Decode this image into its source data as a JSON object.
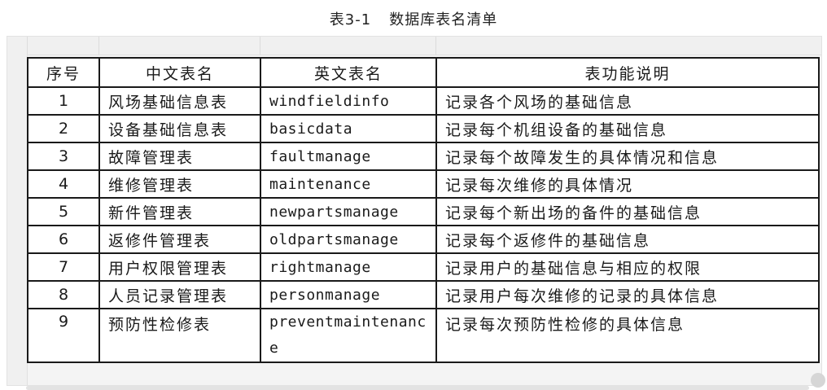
{
  "caption": {
    "number": "表3-1",
    "title": "数据库表名清单"
  },
  "table": {
    "headers": [
      "序号",
      "中文表名",
      "英文表名",
      "表功能说明"
    ],
    "rows": [
      {
        "no": "1",
        "cn": "风场基础信息表",
        "en": "windfieldinfo",
        "desc": "记录各个风场的基础信息"
      },
      {
        "no": "2",
        "cn": "设备基础信息表",
        "en": "basicdata",
        "desc": "记录每个机组设备的基础信息"
      },
      {
        "no": "3",
        "cn": "故障管理表",
        "en": "faultmanage",
        "desc": "记录每个故障发生的具体情况和信息"
      },
      {
        "no": "4",
        "cn": "维修管理表",
        "en": "maintenance",
        "desc": "记录每次维修的具体情况"
      },
      {
        "no": "5",
        "cn": "新件管理表",
        "en": "newpartsmanage",
        "desc": "记录每个新出场的备件的基础信息"
      },
      {
        "no": "6",
        "cn": "返修件管理表",
        "en": "oldpartsmanage",
        "desc": "记录每个返修件的基础信息"
      },
      {
        "no": "7",
        "cn": "用户权限管理表",
        "en": "rightmanage",
        "desc": "记录用户的基础信息与相应的权限"
      },
      {
        "no": "8",
        "cn": "人员记录管理表",
        "en": "personmanage",
        "desc": "记录用户每次维修的记录的具体信息"
      },
      {
        "no": "9",
        "cn": "预防性检修表",
        "en": "preventmaintenance",
        "desc": "记录每次预防性检修的具体信息"
      }
    ]
  }
}
